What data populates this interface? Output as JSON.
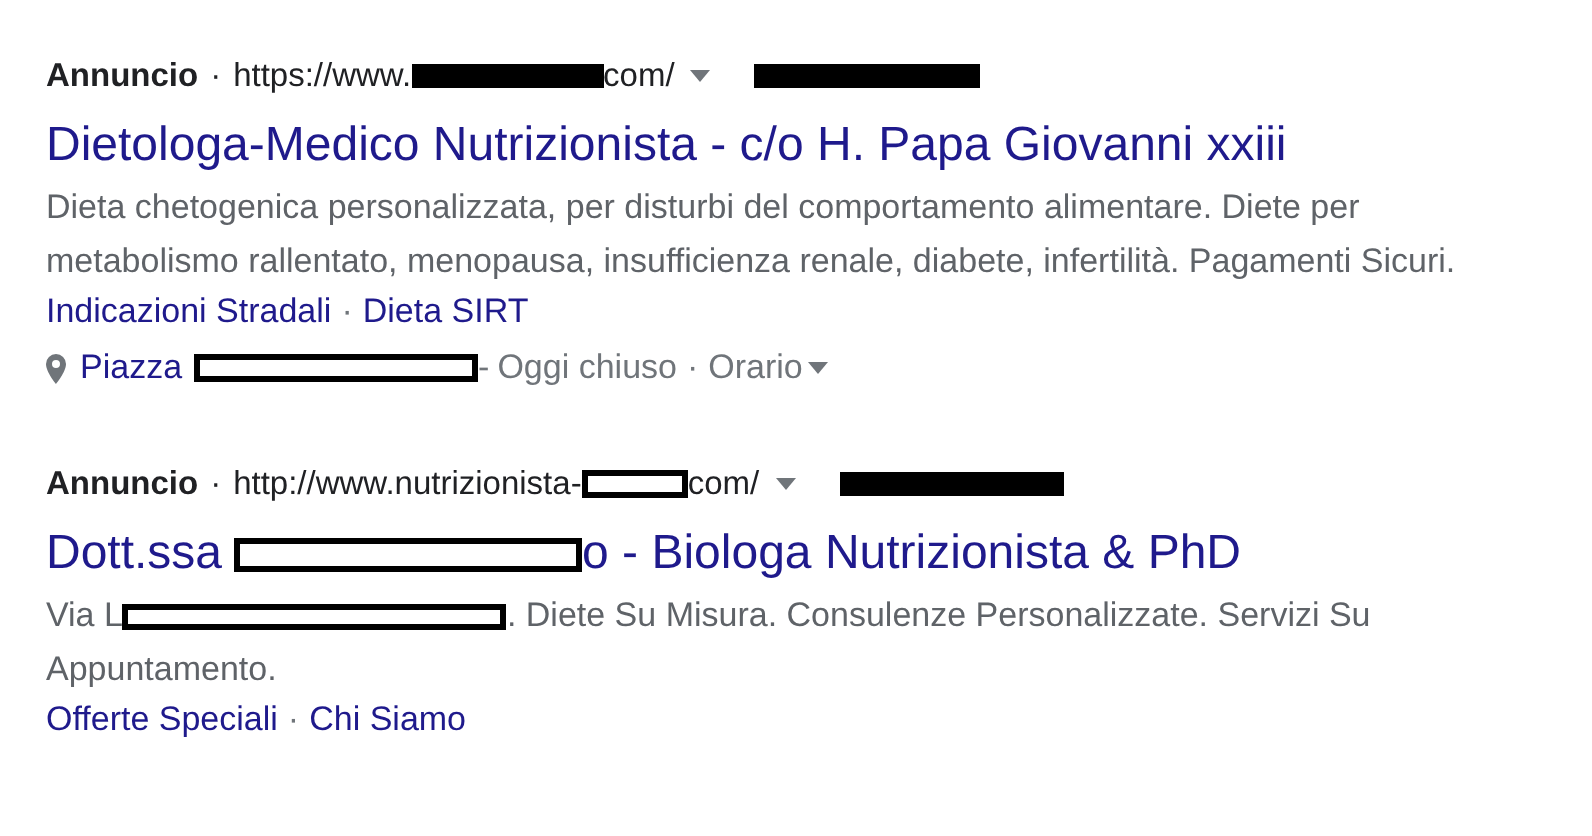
{
  "ads": [
    {
      "label": "Annuncio",
      "separator": "·",
      "url": [
        {
          "kind": "text",
          "text": "https://www."
        },
        {
          "kind": "redacted-solid"
        },
        {
          "kind": "text",
          "text": "com/"
        }
      ],
      "phone": {
        "kind": "redacted-solid"
      },
      "title": [
        {
          "kind": "text",
          "text": "Dietologa-Medico Nutrizionista - c/o H. Papa Giovanni xxiii"
        }
      ],
      "description": [
        {
          "kind": "text",
          "text": "Dieta chetogenica personalizzata, per disturbi del comportamento alimentare. Diete per metabolismo rallentato, menopausa, insufficienza renale, diabete, infertilità. Pagamenti Sicuri."
        }
      ],
      "sitelinks": [
        "Indicazioni Stradali",
        "Dieta SIRT"
      ],
      "location": {
        "address": [
          {
            "kind": "text",
            "text": "Piazza"
          },
          {
            "kind": "redacted-outline"
          },
          {
            "kind": "text",
            "text": "-"
          }
        ],
        "status": "Oggi chiuso",
        "hours": "Orario"
      }
    },
    {
      "label": "Annuncio",
      "separator": "·",
      "url": [
        {
          "kind": "text",
          "text": "http://www.nutrizionista-"
        },
        {
          "kind": "redacted-outline"
        },
        {
          "kind": "text",
          "text": "com/"
        }
      ],
      "phone": {
        "kind": "redacted-solid"
      },
      "title": [
        {
          "kind": "text",
          "text": "Dott.ssa"
        },
        {
          "kind": "redacted-outline"
        },
        {
          "kind": "text",
          "text": "o - Biologa Nutrizionista & PhD"
        }
      ],
      "description": [
        {
          "kind": "text",
          "text": "Via L"
        },
        {
          "kind": "redacted-outline"
        },
        {
          "kind": "text",
          "text": ". Diete Su Misura. Consulenze Personalizzate. Servizi Su"
        },
        {
          "kind": "line-break"
        },
        {
          "kind": "text",
          "text": "Appuntamento."
        }
      ],
      "sitelinks": [
        "Offerte Speciali",
        "Chi Siamo"
      ]
    }
  ]
}
